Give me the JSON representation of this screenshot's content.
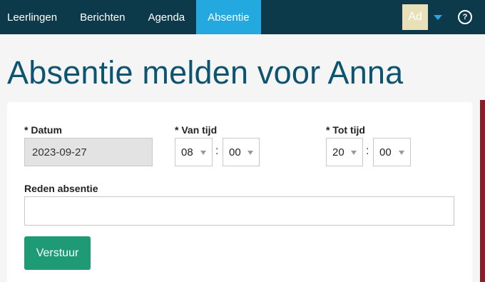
{
  "nav": {
    "items": [
      {
        "label": "Leerlingen",
        "active": false
      },
      {
        "label": "Berichten",
        "active": false
      },
      {
        "label": "Agenda",
        "active": false
      },
      {
        "label": "Absentie",
        "active": true
      }
    ],
    "avatar_initials": "Ad",
    "help_symbol": "?",
    "accent_color": "#23a9df",
    "bar_color": "#0d3a4a"
  },
  "page": {
    "title": "Absentie melden voor Anna"
  },
  "form": {
    "date_label": "* Datum",
    "date_value": "2023-09-27",
    "from_label": "* Van tijd",
    "from_hour": "08",
    "from_minute": "00",
    "to_label": "* Tot tijd",
    "to_hour": "20",
    "to_minute": "00",
    "time_separator": ":",
    "reason_label": "Reden absentie",
    "reason_value": "",
    "submit_label": "Verstuur",
    "submit_color": "#1e9a75"
  }
}
